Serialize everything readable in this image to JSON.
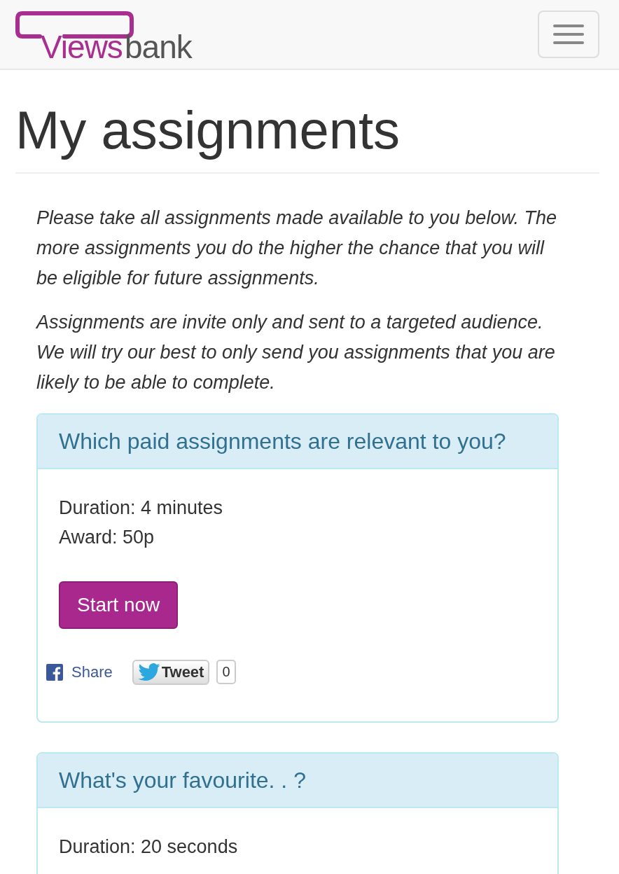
{
  "navbar": {
    "logo": {
      "views": "Views",
      "bank": "bank"
    }
  },
  "title": "My assignments",
  "intro": [
    "Please take all assignments made available to you below. The more assignments you do the higher the chance that you will be eligible for future assignments.",
    "Assignments are invite only and sent to a targeted audience. We will try our best to only send you assignments that you are likely to be able to complete."
  ],
  "assignments": [
    {
      "heading": "Which paid assignments are relevant to you?",
      "lines": [
        "Duration: 4 minutes",
        "Award: 50p"
      ],
      "button": "Start now",
      "share": {
        "facebook": "Share",
        "tweet": "Tweet",
        "tweet_count": "0"
      }
    },
    {
      "heading": "What's your favourite. . ?",
      "lines": [
        "Duration: 20 seconds"
      ]
    }
  ]
}
